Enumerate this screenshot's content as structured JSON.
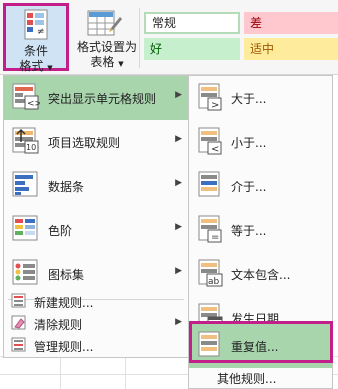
{
  "ribbon": {
    "conditional_format": {
      "line1": "条件",
      "line2": "格式"
    },
    "format_as_table": {
      "line1": "格式设置为",
      "line2": "表格"
    },
    "styles": [
      {
        "label": "常规",
        "bg": "#ffffff",
        "color": "#222222"
      },
      {
        "label": "差",
        "bg": "#ffc7ce",
        "color": "#9c0006"
      },
      {
        "label": "好",
        "bg": "#c6efce",
        "color": "#006100"
      },
      {
        "label": "适中",
        "bg": "#ffeb9c",
        "color": "#9c5700"
      }
    ]
  },
  "menu": {
    "items": [
      {
        "label": "突出显示单元格规则",
        "icon": "highlight-cells-rules-icon",
        "submenu": true,
        "highlighted": true
      },
      {
        "label": "项目选取规则",
        "icon": "top-bottom-rules-icon",
        "submenu": true
      },
      {
        "label": "数据条",
        "icon": "data-bars-icon",
        "submenu": true
      },
      {
        "label": "色阶",
        "icon": "color-scales-icon",
        "submenu": true
      },
      {
        "label": "图标集",
        "icon": "icon-sets-icon",
        "submenu": true
      }
    ],
    "small_items": [
      {
        "label": "新建规则...",
        "icon": "new-rule-icon"
      },
      {
        "label": "清除规则",
        "icon": "clear-rules-icon",
        "submenu": true
      },
      {
        "label": "管理规则...",
        "icon": "manage-rules-icon"
      }
    ]
  },
  "submenu": {
    "items": [
      {
        "label": "大于...",
        "icon": "greater-than-icon"
      },
      {
        "label": "小于...",
        "icon": "less-than-icon"
      },
      {
        "label": "介于...",
        "icon": "between-icon"
      },
      {
        "label": "等于...",
        "icon": "equal-to-icon"
      },
      {
        "label": "文本包含...",
        "icon": "text-contains-icon"
      },
      {
        "label": "发生日期...",
        "icon": "date-occurring-icon"
      },
      {
        "label": "重复值...",
        "icon": "duplicate-values-icon",
        "highlighted": true
      }
    ],
    "more_rules": "其他规则..."
  },
  "colors": {
    "highlight": "#a9d5ad",
    "callout": "#c21f8a"
  }
}
